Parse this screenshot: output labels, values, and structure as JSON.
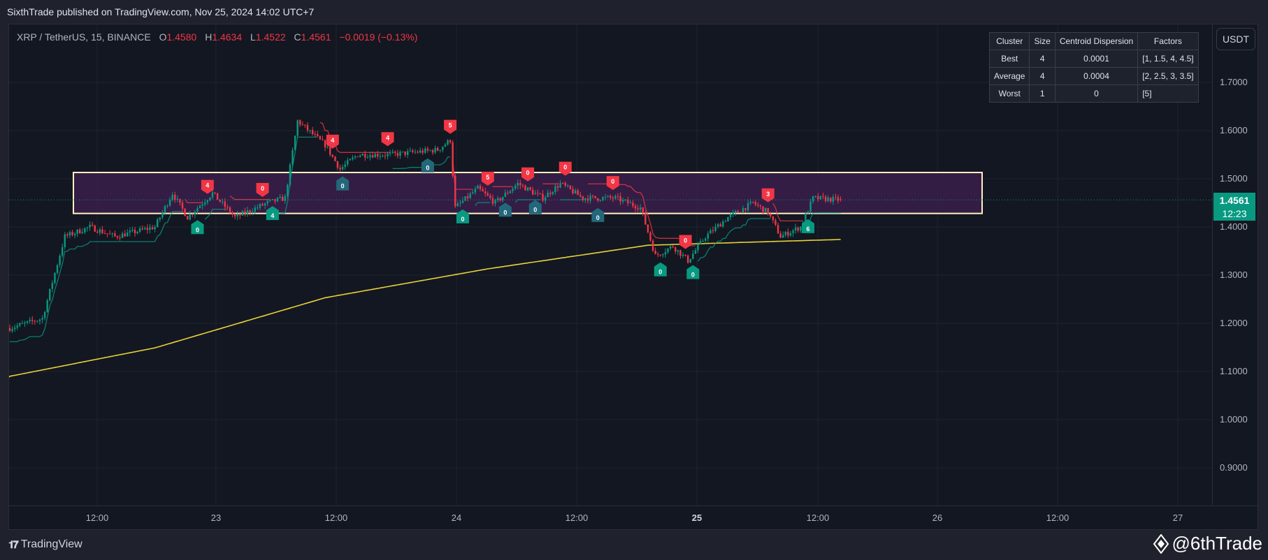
{
  "header": {
    "published": "SixthTrade published on TradingView.com, Nov 25, 2024 14:02 UTC+7"
  },
  "legend": {
    "symbol": "XRP / TetherUS, 15, BINANCE",
    "o_label": "O",
    "o": "1.4580",
    "h_label": "H",
    "h": "1.4634",
    "l_label": "L",
    "l": "1.4522",
    "c_label": "C",
    "c": "1.4561",
    "change": "−0.0019 (−0.13%)"
  },
  "cluster_table": {
    "headers": [
      "Cluster",
      "Size",
      "Centroid Dispersion",
      "Factors"
    ],
    "rows": [
      [
        "Best",
        "4",
        "0.0001",
        "[1, 1.5, 4, 4.5]"
      ],
      [
        "Average",
        "4",
        "0.0004",
        "[2, 2.5, 3, 3.5]"
      ],
      [
        "Worst",
        "1",
        "0",
        "[5]"
      ]
    ]
  },
  "currency_button": "USDT",
  "price_axis": [
    "1.7000",
    "1.6000",
    "1.5000",
    "1.4000",
    "1.3000",
    "1.2000",
    "1.1000",
    "1.0000",
    "0.9000"
  ],
  "time_axis": [
    {
      "label": "12:00",
      "bold": false
    },
    {
      "label": "23",
      "bold": false
    },
    {
      "label": "12:00",
      "bold": false
    },
    {
      "label": "24",
      "bold": false
    },
    {
      "label": "12:00",
      "bold": false
    },
    {
      "label": "25",
      "bold": true
    },
    {
      "label": "12:00",
      "bold": false
    },
    {
      "label": "26",
      "bold": false
    },
    {
      "label": "12:00",
      "bold": false
    },
    {
      "label": "27",
      "bold": false
    }
  ],
  "last_price": {
    "price": "1.4561",
    "countdown": "12:23"
  },
  "colors": {
    "up": "#089981",
    "down": "#f23645",
    "ma": "#e8d238",
    "zone_fill": "#3a1f4a",
    "zone_border": "#fff2c0",
    "buy_alt": "#22687a"
  },
  "zone": {
    "top": 1.513,
    "bottom": 1.428
  },
  "price_path": [
    [
      0,
      1.19
    ],
    [
      13,
      1.21
    ],
    [
      22,
      1.38
    ],
    [
      32,
      1.4
    ],
    [
      42,
      1.38
    ],
    [
      58,
      1.4
    ],
    [
      65,
      1.47
    ],
    [
      71,
      1.42
    ],
    [
      81,
      1.47
    ],
    [
      90,
      1.42
    ],
    [
      103,
      1.45
    ],
    [
      110,
      1.46
    ],
    [
      115,
      1.62
    ],
    [
      126,
      1.57
    ],
    [
      132,
      1.52
    ],
    [
      139,
      1.55
    ],
    [
      152,
      1.55
    ],
    [
      171,
      1.56
    ],
    [
      176,
      1.58
    ],
    [
      178,
      1.44
    ],
    [
      187,
      1.48
    ],
    [
      194,
      1.45
    ],
    [
      203,
      1.49
    ],
    [
      213,
      1.46
    ],
    [
      220,
      1.49
    ],
    [
      229,
      1.46
    ],
    [
      242,
      1.46
    ],
    [
      252,
      1.44
    ],
    [
      258,
      1.34
    ],
    [
      265,
      1.36
    ],
    [
      271,
      1.33
    ],
    [
      278,
      1.38
    ],
    [
      287,
      1.42
    ],
    [
      297,
      1.45
    ],
    [
      303,
      1.43
    ],
    [
      308,
      1.38
    ],
    [
      316,
      1.4
    ],
    [
      321,
      1.46
    ],
    [
      332,
      1.456
    ]
  ],
  "ma_path": [
    [
      0,
      1.09
    ],
    [
      58,
      1.149
    ],
    [
      126,
      1.253
    ],
    [
      191,
      1.313
    ],
    [
      255,
      1.362
    ],
    [
      332,
      1.374
    ]
  ],
  "signals": [
    {
      "type": "sell",
      "bar": 79,
      "label": "4"
    },
    {
      "type": "sell",
      "bar": 101,
      "label": "0"
    },
    {
      "type": "sell",
      "bar": 129,
      "label": "4"
    },
    {
      "type": "sell",
      "bar": 151,
      "label": "4"
    },
    {
      "type": "sell",
      "bar": 176,
      "label": "5"
    },
    {
      "type": "sell",
      "bar": 191,
      "label": "5"
    },
    {
      "type": "sell",
      "bar": 207,
      "label": "0"
    },
    {
      "type": "sell",
      "bar": 222,
      "label": "0"
    },
    {
      "type": "sell",
      "bar": 241,
      "label": "0"
    },
    {
      "type": "sell",
      "bar": 270,
      "label": "0"
    },
    {
      "type": "sell",
      "bar": 303,
      "label": "3"
    },
    {
      "type": "buy",
      "bar": 75,
      "label": "0",
      "alt": false
    },
    {
      "type": "buy",
      "bar": 105,
      "label": "4",
      "alt": false
    },
    {
      "type": "buy",
      "bar": 133,
      "label": "0",
      "alt": true
    },
    {
      "type": "buy",
      "bar": 167,
      "label": "0",
      "alt": true
    },
    {
      "type": "buy",
      "bar": 181,
      "label": "0",
      "alt": false
    },
    {
      "type": "buy",
      "bar": 198,
      "label": "0",
      "alt": true
    },
    {
      "type": "buy",
      "bar": 210,
      "label": "0",
      "alt": true
    },
    {
      "type": "buy",
      "bar": 235,
      "label": "0",
      "alt": true
    },
    {
      "type": "buy",
      "bar": 260,
      "label": "0",
      "alt": false
    },
    {
      "type": "buy",
      "bar": 273,
      "label": "0",
      "alt": false
    },
    {
      "type": "buy",
      "bar": 319,
      "label": "6",
      "alt": false
    }
  ],
  "footer": {
    "brand": "TradingView",
    "author": "@6thTrade"
  }
}
